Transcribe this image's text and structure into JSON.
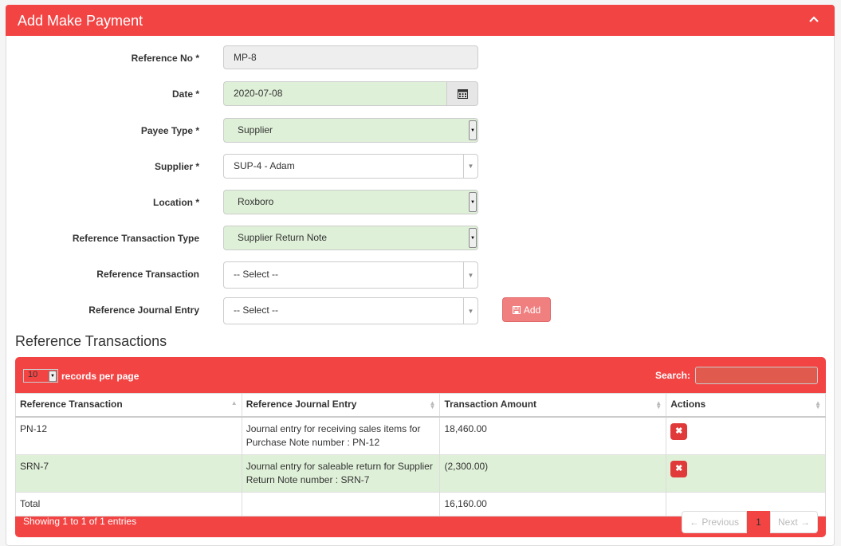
{
  "panel": {
    "title": "Add Make Payment"
  },
  "form": {
    "reference_no": {
      "label": "Reference No *",
      "value": "MP-8"
    },
    "date": {
      "label": "Date *",
      "value": "2020-07-08"
    },
    "payee_type": {
      "label": "Payee Type *",
      "value": "Supplier"
    },
    "supplier": {
      "label": "Supplier *",
      "value": "SUP-4 - Adam"
    },
    "location": {
      "label": "Location *",
      "value": "Roxboro"
    },
    "ref_txn_type": {
      "label": "Reference Transaction Type",
      "value": "Supplier Return Note"
    },
    "ref_txn": {
      "label": "Reference Transaction",
      "value": "-- Select --"
    },
    "ref_journal": {
      "label": "Reference Journal Entry",
      "value": "-- Select --"
    },
    "add_label": "Add"
  },
  "section_title": "Reference Transactions",
  "table": {
    "length_value": "10",
    "length_label": "records per page",
    "search_label": "Search:",
    "columns": [
      "Reference Transaction",
      "Reference Journal Entry",
      "Transaction Amount",
      "Actions"
    ],
    "rows": [
      {
        "ref": "PN-12",
        "journal": "Journal entry for receiving sales items for Purchase Note number : PN-12",
        "amount": "18,460.00"
      },
      {
        "ref": "SRN-7",
        "journal": "Journal entry for saleable return for Supplier Return Note number : SRN-7",
        "amount": "(2,300.00)"
      }
    ],
    "total_label": "Total",
    "total_amount": "16,160.00",
    "info": "Showing 1 to 1 of 1 entries",
    "prev": "← Previous",
    "page": "1",
    "next": "Next →"
  },
  "colors": {
    "accent": "#f34444",
    "success_row": "#dff0d8"
  }
}
